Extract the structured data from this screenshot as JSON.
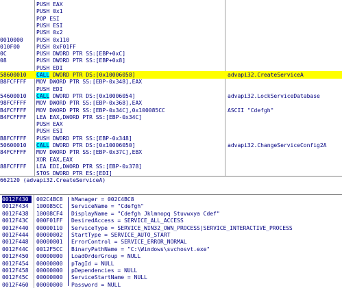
{
  "disasm": {
    "rows": [
      {
        "hex": "",
        "ins": "PUSH EAX",
        "cmt": ""
      },
      {
        "hex": "",
        "ins": "PUSH 0x1",
        "cmt": ""
      },
      {
        "hex": "",
        "ins": "POP ESI",
        "cmt": ""
      },
      {
        "hex": "",
        "ins": "PUSH ESI",
        "cmt": ""
      },
      {
        "hex": "",
        "ins": "PUSH 0x2",
        "cmt": ""
      },
      {
        "hex": "0010000",
        "ins": "PUSH 0x110",
        "cmt": ""
      },
      {
        "hex": "010F00",
        "ins": "PUSH 0xF01FF",
        "cmt": ""
      },
      {
        "hex": "0C",
        "ins": "PUSH DWORD PTR SS:[EBP+0xC]",
        "cmt": ""
      },
      {
        "hex": "08",
        "ins": "PUSH DWORD PTR SS:[EBP+0x8]",
        "cmt": ""
      },
      {
        "hex": "",
        "ins": "PUSH EDI",
        "cmt": ""
      },
      {
        "hex": "58600010",
        "ins": "CALL DWORD PTR DS:[0x10006058]",
        "cmt": "advapi32.CreateServiceA",
        "highlight": true
      },
      {
        "hex": "B8FCFFFF",
        "ins": "MOV DWORD PTR SS:[EBP-0x348],EAX",
        "cmt": ""
      },
      {
        "hex": "",
        "ins": "PUSH EDI",
        "cmt": ""
      },
      {
        "hex": "54600010",
        "ins": "CALL DWORD PTR DS:[0x10006054]",
        "cmt": "advapi32.LockServiceDatabase"
      },
      {
        "hex": "98FCFFFF",
        "ins": "MOV DWORD PTR SS:[EBP-0x368],EAX",
        "cmt": ""
      },
      {
        "hex": "B4FCFFFF",
        "ins": "MOV DWORD PTR SS:[EBP-0x34C],0x100085CC",
        "cmt": "ASCII \"Cdefgh\""
      },
      {
        "hex": "B4FCFFFF",
        "ins": "LEA EAX,DWORD PTR SS:[EBP-0x34C]",
        "cmt": ""
      },
      {
        "hex": "",
        "ins": "PUSH EAX",
        "cmt": ""
      },
      {
        "hex": "",
        "ins": "PUSH ESI",
        "cmt": ""
      },
      {
        "hex": "B8FCFFFF",
        "ins": "PUSH DWORD PTR SS:[EBP-0x348]",
        "cmt": ""
      },
      {
        "hex": "50600010",
        "ins": "CALL DWORD PTR DS:[0x10006050]",
        "cmt": "advapi32.ChangeServiceConfig2A"
      },
      {
        "hex": "84FCFFFF",
        "ins": "MOV DWORD PTR SS:[EBP-0x37C],EBX",
        "cmt": ""
      },
      {
        "hex": "",
        "ins": "XOR EAX,EAX",
        "cmt": ""
      },
      {
        "hex": "88FCFFFF",
        "ins": "LEA EDI,DWORD PTR SS:[EBP-0x378]",
        "cmt": ""
      },
      {
        "hex": "",
        "ins": "STOS DWORD PTR ES:[EDI]",
        "cmt": ""
      }
    ]
  },
  "info": {
    "text": "662120 (advapi32.CreateServiceA)"
  },
  "stack": {
    "rows": [
      {
        "addr": "0012F430",
        "val": "002C4BC8",
        "cmt": "hManager = 002C4BC8",
        "selected": true
      },
      {
        "addr": "0012F434",
        "val": "100085CC",
        "cmt": "ServiceName = \"Cdefgh\""
      },
      {
        "addr": "0012F438",
        "val": "10008CF4",
        "cmt": "DisplayName = \"Cdefgh Jklmnopq Stuvwxya Cdef\""
      },
      {
        "addr": "0012F43C",
        "val": "000F01FF",
        "cmt": "DesiredAccess = SERVICE_ALL_ACCESS"
      },
      {
        "addr": "0012F440",
        "val": "00000110",
        "cmt": "ServiceType = SERVICE_WIN32_OWN_PROCESS|SERVICE_INTERACTIVE_PROCESS"
      },
      {
        "addr": "0012F444",
        "val": "00000002",
        "cmt": "StartType = SERVICE_AUTO_START"
      },
      {
        "addr": "0012F448",
        "val": "00000001",
        "cmt": "ErrorControl = SERVICE_ERROR_NORMAL"
      },
      {
        "addr": "0012F44C",
        "val": "0012F5CC",
        "cmt": "BinaryPathName = \"C:\\Windows\\svchosvt.exe\""
      },
      {
        "addr": "0012F450",
        "val": "00000000",
        "cmt": "LoadOrderGroup = NULL"
      },
      {
        "addr": "0012F454",
        "val": "00000000",
        "cmt": "pTagId = NULL"
      },
      {
        "addr": "0012F458",
        "val": "00000000",
        "cmt": "pDependencies = NULL"
      },
      {
        "addr": "0012F45C",
        "val": "00000000",
        "cmt": "ServiceStartName = NULL"
      },
      {
        "addr": "0012F460",
        "val": "00000000",
        "cmt": "Password = NULL"
      }
    ]
  }
}
